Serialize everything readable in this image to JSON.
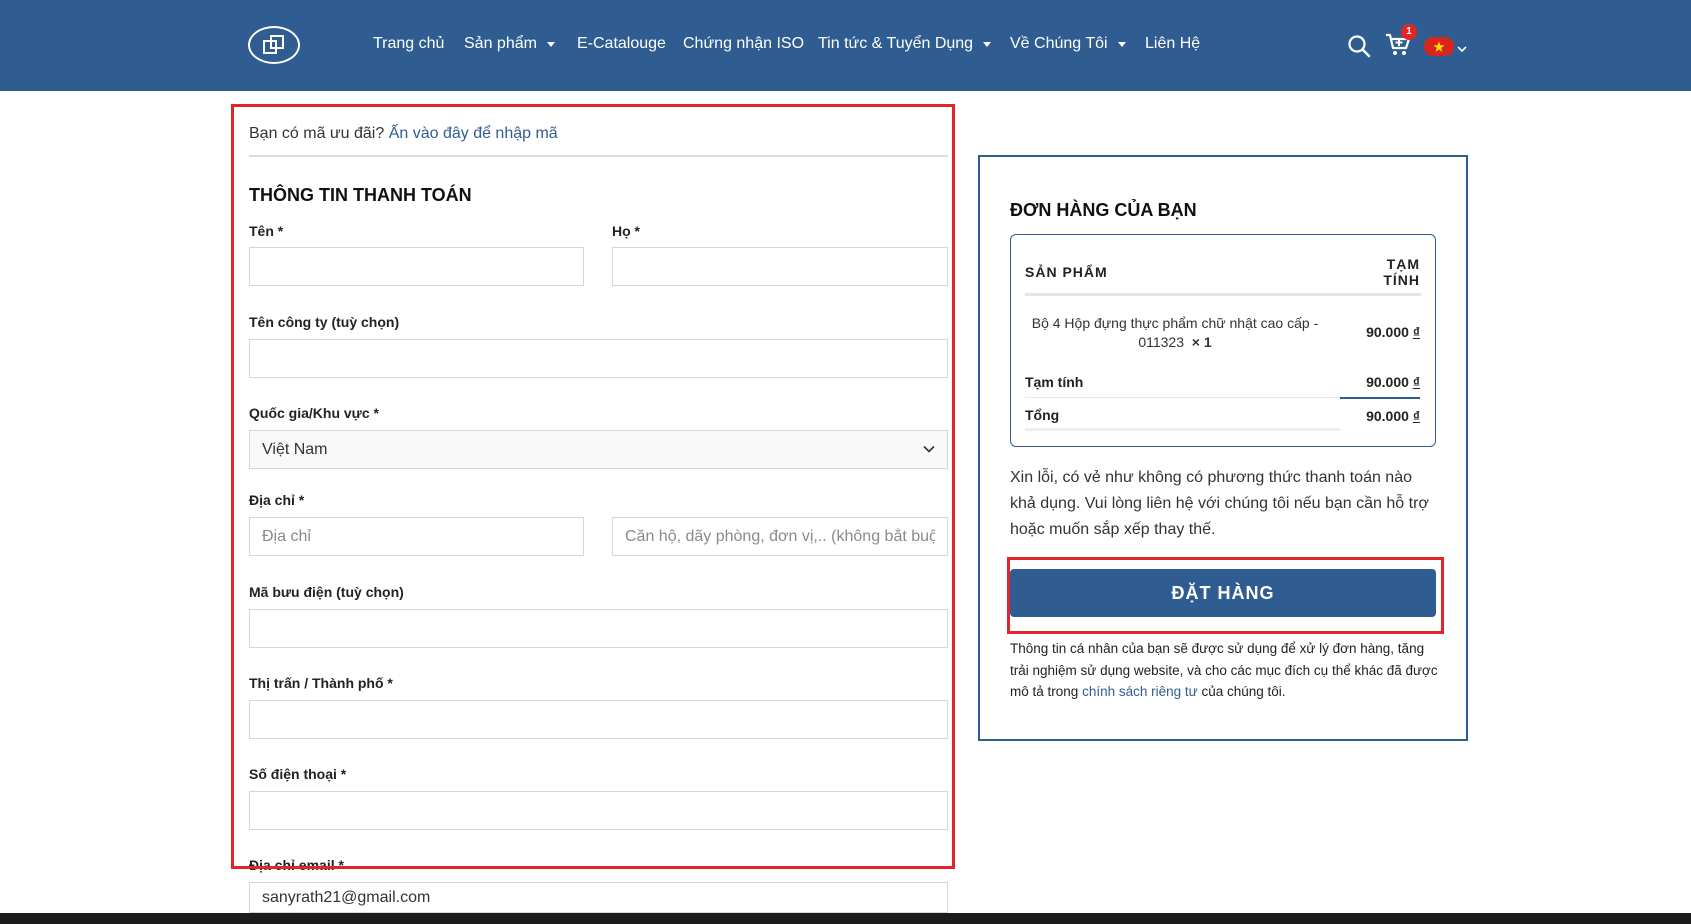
{
  "header": {
    "nav": [
      {
        "label": "Trang chủ",
        "dropdown": false
      },
      {
        "label": "Sản phẩm",
        "dropdown": true
      },
      {
        "label": "E-Catalouge",
        "dropdown": false
      },
      {
        "label": "Chứng nhận ISO",
        "dropdown": false
      },
      {
        "label": "Tin tức & Tuyển Dụng",
        "dropdown": true
      },
      {
        "label": "Về Chúng Tôi",
        "dropdown": true
      },
      {
        "label": "Liên Hệ",
        "dropdown": false
      }
    ],
    "cart_count": "1",
    "icons": [
      "logo-icon",
      "search-icon",
      "cart-icon",
      "vietnam-flag-icon",
      "chevron-down-icon"
    ],
    "colors": {
      "brand": "#2f5d92",
      "badge": "#e42525",
      "highlight": "#e1262b"
    }
  },
  "coupon": {
    "question": "Bạn có mã ưu đãi?",
    "link": "Ấn vào đây để nhập mã"
  },
  "billing": {
    "title": "THÔNG TIN THANH TOÁN",
    "first_name_label": "Tên *",
    "last_name_label": "Họ *",
    "company_label": "Tên công ty (tuỳ chọn)",
    "country_label": "Quốc gia/Khu vực *",
    "country_value": "Việt Nam",
    "address_label": "Địa chỉ *",
    "address_placeholder": "Địa chỉ",
    "address2_placeholder": "Căn hộ, dãy phòng, đơn vị,.. (không bắt buộc)",
    "postcode_label": "Mã bưu điện (tuỳ chọn)",
    "city_label": "Thị trấn / Thành phố *",
    "phone_label": "Số điện thoại *",
    "email_label": "Địa chỉ email *",
    "email_value": "sanyrath21@gmail.com"
  },
  "order": {
    "title": "ĐƠN HÀNG CỦA BẠN",
    "col_product": "SẢN PHẨM",
    "col_subtotal": "TẠM TÍNH",
    "item_name": "Bộ 4 Hộp đựng thực phẩm chữ nhật cao cấp - 011323",
    "item_qty": "× 1",
    "item_price": "90.000",
    "currency": "₫",
    "subtotal_label": "Tạm tính",
    "subtotal_value": "90.000",
    "total_label": "Tổng",
    "total_value": "90.000",
    "notice": "Xin lỗi, có vẻ như không có phương thức thanh toán nào khả dụng. Vui lòng liên hệ với chúng tôi nếu bạn cần hỗ trợ hoặc muốn sắp xếp thay thế.",
    "button": "ĐẶT HÀNG",
    "privacy_before": "Thông tin cá nhân của bạn sẽ được sử dụng để xử lý đơn hàng, tăng trải nghiệm sử dụng website, và cho các mục đích cụ thể khác đã được mô tả trong",
    "privacy_link": "chính sách riêng tư",
    "privacy_after": "của chúng tôi."
  }
}
